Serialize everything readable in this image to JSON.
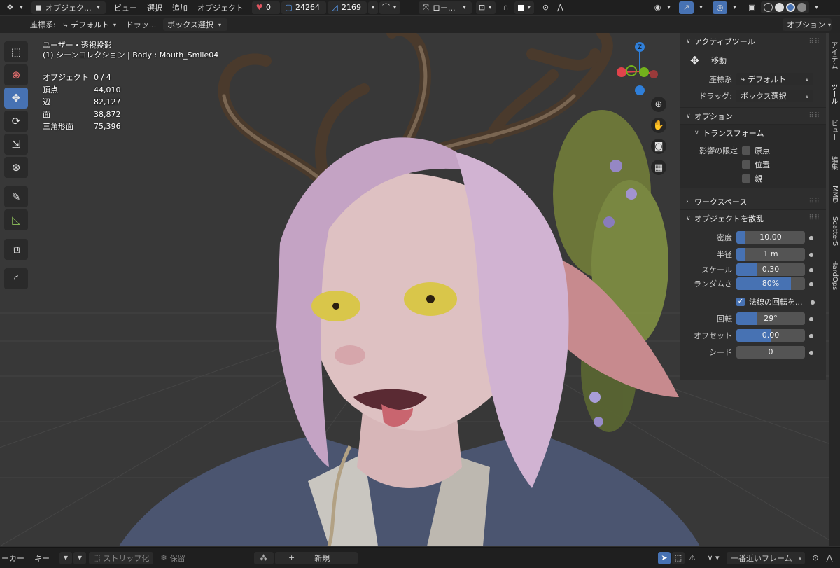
{
  "header": {
    "mode_label": "オブジェク...",
    "menus": [
      "ビュー",
      "選択",
      "追加",
      "オブジェクト"
    ],
    "stats": {
      "heart_count": "0",
      "vertex_count": "24264",
      "face_count": "2169"
    },
    "transform_orientation": "ロー..."
  },
  "subheader": {
    "coord_label": "座標系:",
    "coord_value": "デフォルト",
    "drag_label": "ドラッ...",
    "drag_value": "ボックス選択",
    "options_label": "オプション"
  },
  "viewport": {
    "view_name": "ユーザー・透視投影",
    "collection_line": "(1) シーンコレクション | Body : Mouth_Smile04",
    "stats": [
      {
        "key": "オブジェクト",
        "value": "0 / 4"
      },
      {
        "key": "頂点",
        "value": "44,010"
      },
      {
        "key": "辺",
        "value": "82,127"
      },
      {
        "key": "面",
        "value": "38,872"
      },
      {
        "key": "三角形面",
        "value": "75,396"
      }
    ],
    "gizmo_axis_label": "Z"
  },
  "npanel": {
    "tabs": [
      "アイテム",
      "ツール",
      "ビュー",
      "編集",
      "MMD",
      "Scatter5",
      "HardOps"
    ],
    "active_tool": {
      "title": "アクティブツール",
      "tool_name": "移動",
      "coord_label": "座標系",
      "coord_value": "デフォルト",
      "drag_label": "ドラッグ:",
      "drag_value": "ボックス選択"
    },
    "options": {
      "title": "オプション",
      "transform_title": "トランスフォーム",
      "affect_label": "影響の限定",
      "affect_items": [
        "原点",
        "位置",
        "親"
      ]
    },
    "workspace_title": "ワークスペース",
    "scatter": {
      "title": "オブジェクトを散乱",
      "density_label": "密度",
      "density_value": "10.00",
      "density_fill": 0.12,
      "radius_label": "半径",
      "radius_value": "1 m",
      "radius_fill": 0.12,
      "scale_label": "スケール",
      "scale_value": "0.30",
      "scale_fill": 0.3,
      "random_label": "ランダムさ",
      "random_value": "80%",
      "random_fill": 0.8,
      "normal_label": "法線の回転を...",
      "rotation_label": "回転",
      "rotation_value": "29°",
      "rotation_fill": 0.3,
      "offset_label": "オフセット",
      "offset_value": "0.00",
      "offset_fill": 0.5,
      "seed_label": "シード",
      "seed_value": "0"
    }
  },
  "timeline": {
    "keying_label": "ーカー",
    "key_label": "キー",
    "strip_label": "ストリップ化",
    "keep_label": "保留",
    "new_label": "新規",
    "frame_label": "一番近いフレーム"
  },
  "colors": {
    "accent": "#4772b3",
    "axis_x": "#e0434b",
    "axis_y": "#73b11c",
    "axis_z": "#2f7fd9"
  }
}
